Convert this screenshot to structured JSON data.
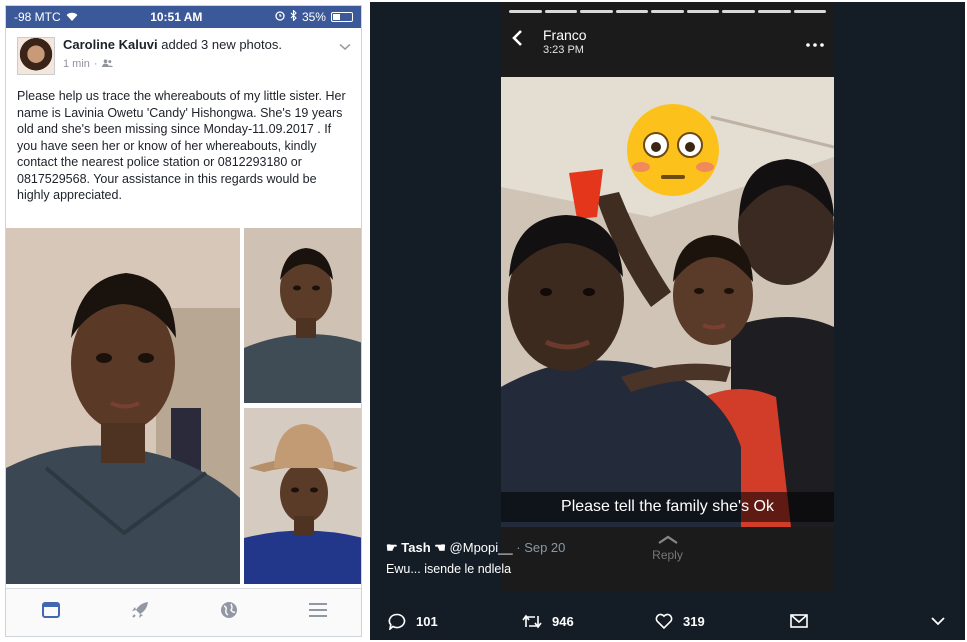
{
  "left_post": {
    "status": {
      "carrier": "-98 MTC",
      "time": "10:51 AM",
      "battery": "35%"
    },
    "author": "Caroline Kaluvi",
    "action_text": " added 3 new photos.",
    "timestamp": "1 min",
    "body": "Please help us trace the whereabouts of my little sister. Her name is Lavinia Owetu 'Candy' Hishongwa. She's 19 years old and she's been missing since Monday-11.09.2017 . If you have seen her or know of her whereabouts, kindly contact the nearest police station or 0812293180 or 0817529568. Your assistance in this regards would be highly appreciated.",
    "tabbar_icons": [
      "news-feed-icon",
      "rocket-icon",
      "globe-icon",
      "menu-icon"
    ],
    "colors": {
      "brand": "#3b5998",
      "tab_active": "#4267b2",
      "tab_inactive": "#9197a3"
    }
  },
  "right_tweet": {
    "snap": {
      "name": "Franco",
      "time": "3:23 PM",
      "caption": "Please tell the family she's Ok",
      "reply_label": "Reply"
    },
    "author_display": "☛ Tash ☚",
    "author_handle": "@Mpopi__",
    "date": "· Sep 20",
    "reply_text": "Ewu... isende le ndlela",
    "actions": {
      "replies": "101",
      "retweets": "946",
      "likes": "319"
    },
    "colors": {
      "background": "#141d26",
      "muted": "#8899a6"
    }
  }
}
